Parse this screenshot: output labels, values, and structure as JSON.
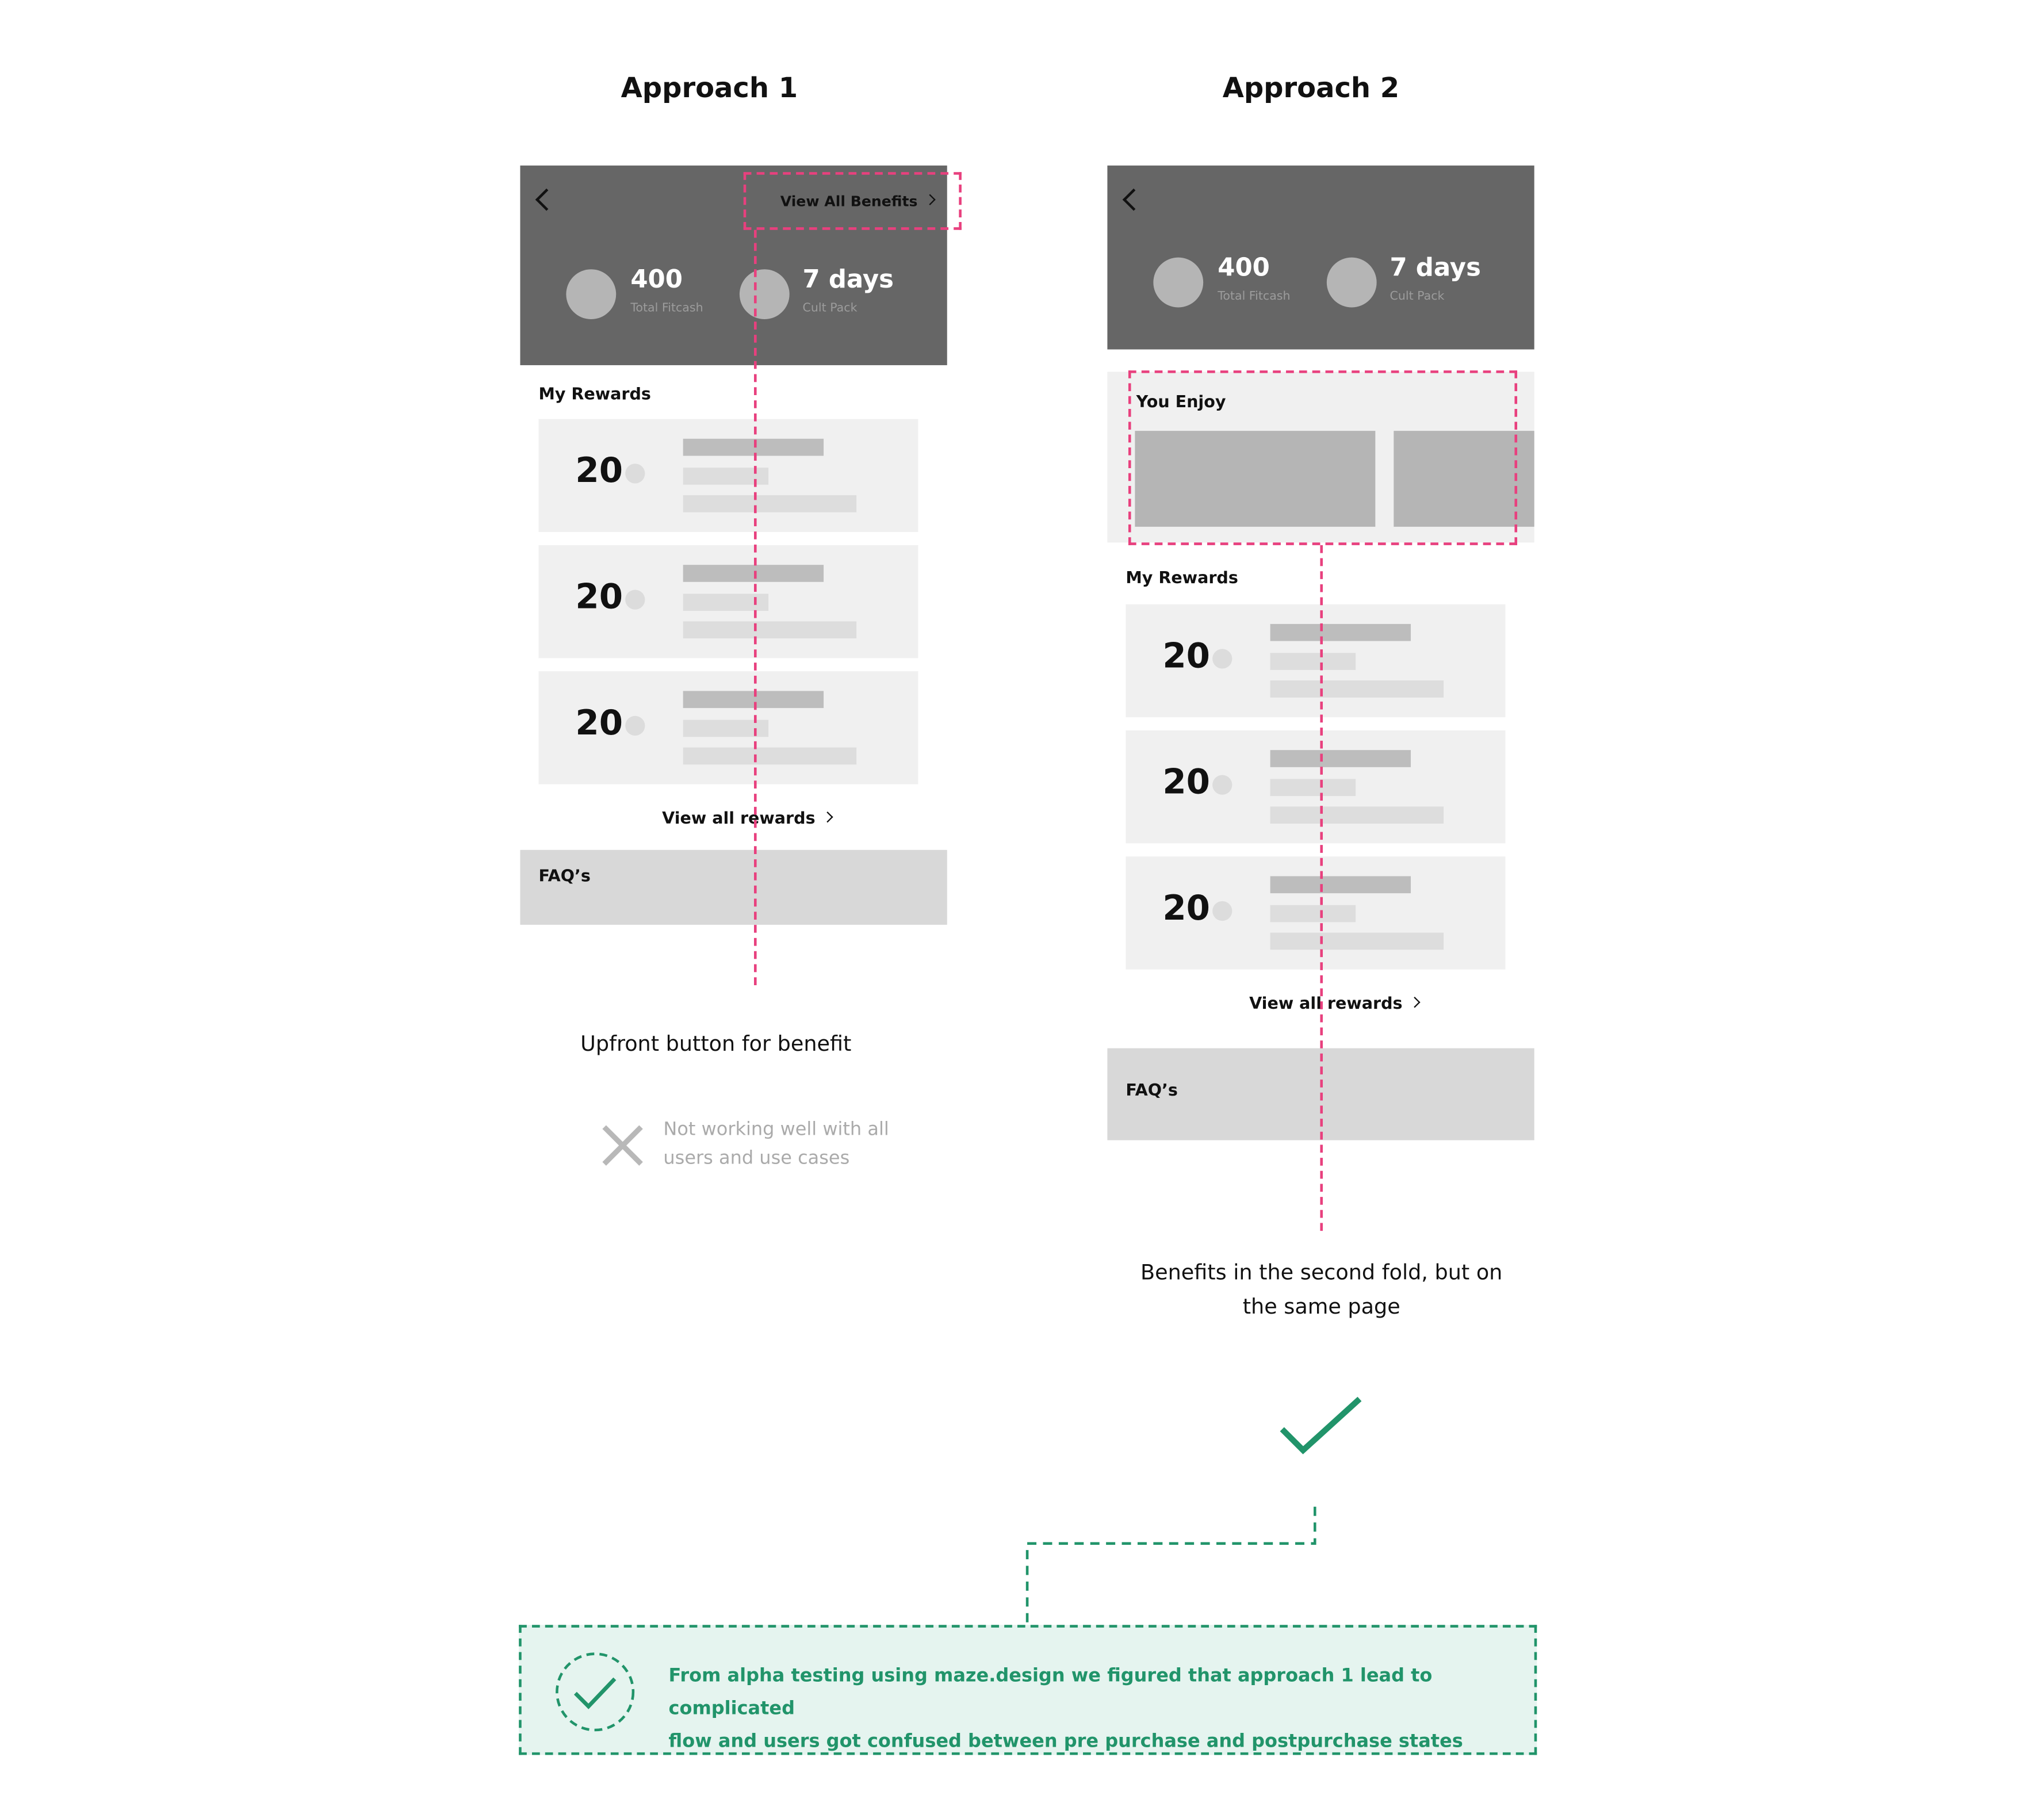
{
  "approach1": {
    "heading": "Approach 1",
    "header": {
      "view_all_benefits": "View All Benefits",
      "stat1_value": "400",
      "stat1_label": "Total Fitcash",
      "stat2_value": "7 days",
      "stat2_label": "Cult Pack"
    },
    "rewards_title": "My Rewards",
    "rewards": [
      {
        "value": "20"
      },
      {
        "value": "20"
      },
      {
        "value": "20"
      }
    ],
    "view_all_rewards": "View all rewards",
    "faq": "FAQ’s",
    "caption": "Upfront button for benefit",
    "verdict": {
      "line1": "Not working well with all",
      "line2": "users and use cases",
      "icon": "cross-icon"
    }
  },
  "approach2": {
    "heading": "Approach 2",
    "header": {
      "stat1_value": "400",
      "stat1_label": "Total Fitcash",
      "stat2_value": "7 days",
      "stat2_label": "Cult Pack"
    },
    "you_enjoy_title": "You Enjoy",
    "rewards_title": "My Rewards",
    "rewards": [
      {
        "value": "20"
      },
      {
        "value": "20"
      },
      {
        "value": "20"
      }
    ],
    "view_all_rewards": "View all rewards",
    "faq": "FAQ’s",
    "caption_line1": "Benefits in the second fold, but on",
    "caption_line2": "the same page",
    "verdict_icon": "check-icon"
  },
  "conclusion": {
    "line1": "From alpha testing using maze.design we figured that approach 1 lead to complicated",
    "line2": "flow and users got confused between pre purchase and postpurchase states",
    "icon": "check-circle-icon"
  },
  "colors": {
    "highlight": "#e8407e",
    "success": "#21946a",
    "success_bg": "#e5f4ef",
    "header": "#666666"
  }
}
